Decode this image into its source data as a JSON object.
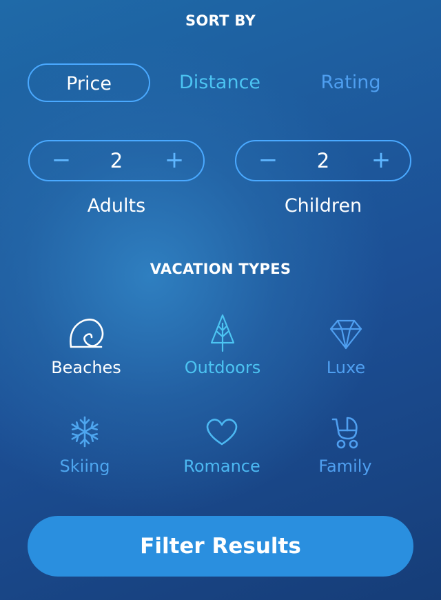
{
  "sort": {
    "title": "SORT BY",
    "options": [
      {
        "label": "Price",
        "selected": true,
        "color": "#ffffff"
      },
      {
        "label": "Distance",
        "selected": false,
        "color": "#4cc4f2"
      },
      {
        "label": "Rating",
        "selected": false,
        "color": "#4f9ff0"
      }
    ]
  },
  "guests": {
    "adults": {
      "value": "2",
      "label": "Adults",
      "minus": "−",
      "plus": "+"
    },
    "children": {
      "value": "2",
      "label": "Children",
      "minus": "−",
      "plus": "+"
    }
  },
  "vacation": {
    "title": "VACATION TYPES",
    "types": [
      {
        "label": "Beaches",
        "icon": "shell-icon",
        "selected": true,
        "color": "#ffffff"
      },
      {
        "label": "Outdoors",
        "icon": "tree-icon",
        "selected": false,
        "color": "#4cc4f2"
      },
      {
        "label": "Luxe",
        "icon": "diamond-icon",
        "selected": false,
        "color": "#4f9ff0"
      },
      {
        "label": "Skiing",
        "icon": "snowflake-icon",
        "selected": false,
        "color": "#4ea6ef"
      },
      {
        "label": "Romance",
        "icon": "heart-icon",
        "selected": false,
        "color": "#4cb8f2"
      },
      {
        "label": "Family",
        "icon": "stroller-icon",
        "selected": false,
        "color": "#4f9ff0"
      }
    ]
  },
  "filter_button": {
    "label": "Filter Results",
    "color": "#2a8fdf"
  }
}
